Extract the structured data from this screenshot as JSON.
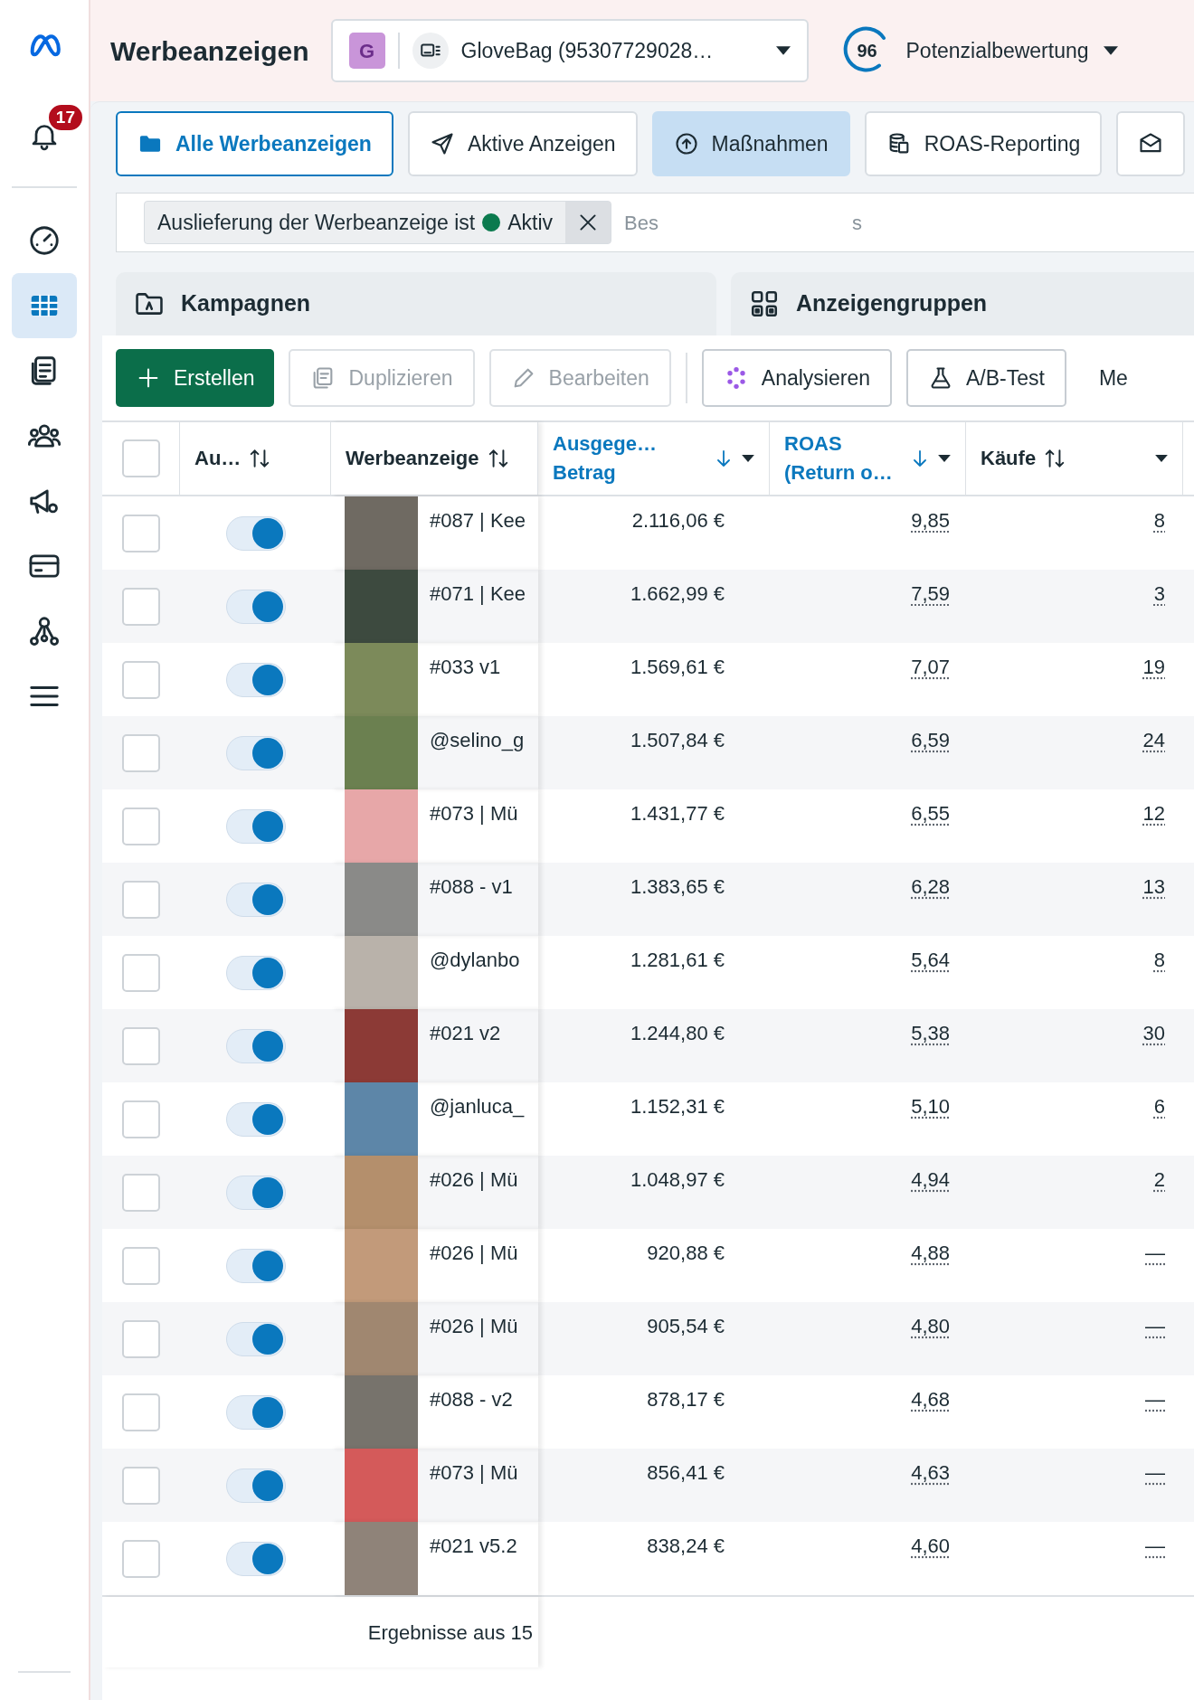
{
  "sidebar": {
    "notification_count": "17",
    "items": [
      {
        "kind": "gauge",
        "selected": false
      },
      {
        "kind": "table",
        "selected": true
      },
      {
        "kind": "documents",
        "selected": false
      },
      {
        "kind": "people",
        "selected": false
      },
      {
        "kind": "megaphone",
        "selected": false
      },
      {
        "kind": "card",
        "selected": false
      },
      {
        "kind": "network",
        "selected": false
      },
      {
        "kind": "menu",
        "selected": false
      }
    ]
  },
  "header": {
    "title": "Werbeanzeigen",
    "account": {
      "initial": "G",
      "name": "GloveBag (95307729028…"
    },
    "score": {
      "value": "96",
      "label": "Potenzialbewertung"
    }
  },
  "view_tabs": [
    {
      "kind": "folder",
      "label": "Alle Werbeanzeigen",
      "selected": true
    },
    {
      "kind": "send",
      "label": "Aktive Anzeigen",
      "selected": false
    },
    {
      "kind": "upload",
      "label": "Maßnahmen",
      "selected": false
    },
    {
      "kind": "coins",
      "label": "ROAS-Reporting",
      "selected": false
    },
    {
      "kind": "mail",
      "selected": false
    }
  ],
  "filter": {
    "chip": {
      "text": "Auslieferung der Werbeanzeige ist",
      "value": "Aktiv"
    },
    "search_fragments": [
      "Bes",
      "s"
    ]
  },
  "level_tabs": [
    {
      "kind": "campaign",
      "label": "Kampagnen"
    },
    {
      "kind": "adsets",
      "label": "Anzeigengruppen"
    }
  ],
  "toolbar": [
    {
      "kind": "create",
      "label": "Erstellen",
      "disabled": false
    },
    {
      "kind": "duplicate",
      "label": "Duplizieren",
      "disabled": true
    },
    {
      "kind": "edit",
      "label": "Bearbeiten",
      "disabled": true
    },
    {
      "kind": "analyze",
      "label": "Analysieren",
      "disabled": false
    },
    {
      "kind": "abtest",
      "label": "A/B-Test",
      "disabled": false
    },
    {
      "kind": "more",
      "label": "Me",
      "disabled": false
    }
  ],
  "table": {
    "columns": [
      {
        "lines": [
          "Au…"
        ],
        "sorted": false,
        "menu": false
      },
      {
        "lines": [
          "Werbeanzeige"
        ],
        "sorted": false,
        "menu": false
      },
      {
        "lines": [
          "Ausgege…",
          "Betrag"
        ],
        "sorted": true,
        "menu": true
      },
      {
        "lines": [
          "ROAS",
          "(Return o…"
        ],
        "sorted": true,
        "menu": true
      },
      {
        "lines": [
          "Käufe"
        ],
        "sorted": false,
        "menu": true
      }
    ],
    "select_all_checked": false,
    "rows": [
      {
        "selected": false,
        "on": true,
        "name": "#087 | Kee",
        "spend": "2.116,06 €",
        "roas": "9,85",
        "purchases": "8"
      },
      {
        "selected": false,
        "on": true,
        "name": "#071 | Kee",
        "spend": "1.662,99 €",
        "roas": "7,59",
        "purchases": "3"
      },
      {
        "selected": false,
        "on": true,
        "name": "#033 v1",
        "spend": "1.569,61 €",
        "roas": "7,07",
        "purchases": "19"
      },
      {
        "selected": false,
        "on": true,
        "name": "@selino_g",
        "spend": "1.507,84 €",
        "roas": "6,59",
        "purchases": "24"
      },
      {
        "selected": false,
        "on": true,
        "name": "#073 | Mü",
        "spend": "1.431,77 €",
        "roas": "6,55",
        "purchases": "12"
      },
      {
        "selected": false,
        "on": true,
        "name": "#088 - v1",
        "spend": "1.383,65 €",
        "roas": "6,28",
        "purchases": "13"
      },
      {
        "selected": false,
        "on": true,
        "name": "@dylanbo",
        "spend": "1.281,61 €",
        "roas": "5,64",
        "purchases": "8"
      },
      {
        "selected": false,
        "on": true,
        "name": "#021 v2",
        "spend": "1.244,80 €",
        "roas": "5,38",
        "purchases": "30"
      },
      {
        "selected": false,
        "on": true,
        "name": "@janluca_",
        "spend": "1.152,31 €",
        "roas": "5,10",
        "purchases": "6"
      },
      {
        "selected": false,
        "on": true,
        "name": "#026 | Mü",
        "spend": "1.048,97 €",
        "roas": "4,94",
        "purchases": "2"
      },
      {
        "selected": false,
        "on": true,
        "name": "#026 | Mü",
        "spend": "920,88 €",
        "roas": "4,88",
        "purchases": "—"
      },
      {
        "selected": false,
        "on": true,
        "name": "#026 | Mü",
        "spend": "905,54 €",
        "roas": "4,80",
        "purchases": "—"
      },
      {
        "selected": false,
        "on": true,
        "name": "#088 - v2",
        "spend": "878,17 €",
        "roas": "4,68",
        "purchases": "—"
      },
      {
        "selected": false,
        "on": true,
        "name": "#073 | Mü",
        "spend": "856,41 €",
        "roas": "4,63",
        "purchases": "—"
      },
      {
        "selected": false,
        "on": true,
        "name": "#021 v5.2",
        "spend": "838,24 €",
        "roas": "4,60",
        "purchases": "—"
      }
    ],
    "footer": "Ergebnisse aus 15"
  }
}
